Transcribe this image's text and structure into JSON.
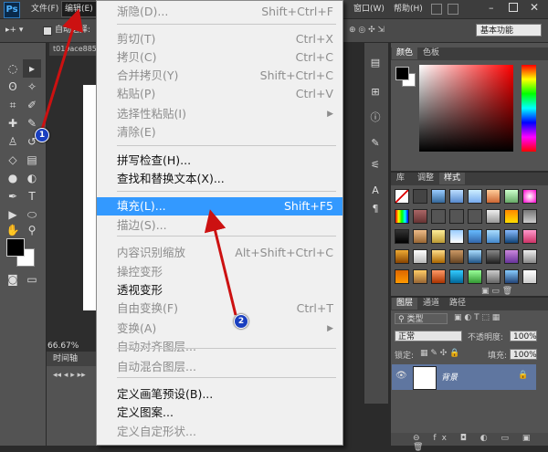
{
  "app": {
    "logo": "Ps"
  },
  "menubar": {
    "file": "文件(F)",
    "edit": "编辑(E)",
    "window": "窗口(W)",
    "help": "帮助(H)"
  },
  "options": {
    "auto_select": "自动选择:",
    "workspace": "基本功能"
  },
  "document": {
    "tab": "t019ace885",
    "zoom": "66.67%"
  },
  "timeline": {
    "label": "时间轴"
  },
  "edit_menu": {
    "items": [
      {
        "label": "渐隐(D)...",
        "shortcut": "Shift+Ctrl+F",
        "state": "disabled"
      },
      {
        "label": "剪切(T)",
        "shortcut": "Ctrl+X",
        "state": "disabled"
      },
      {
        "label": "拷贝(C)",
        "shortcut": "Ctrl+C",
        "state": "disabled"
      },
      {
        "label": "合并拷贝(Y)",
        "shortcut": "Shift+Ctrl+C",
        "state": "disabled"
      },
      {
        "label": "粘贴(P)",
        "shortcut": "Ctrl+V",
        "state": "disabled"
      },
      {
        "label": "选择性粘贴(I)",
        "shortcut": "",
        "state": "disabled"
      },
      {
        "label": "清除(E)",
        "shortcut": "",
        "state": "disabled"
      },
      {
        "label": "拼写检查(H)...",
        "shortcut": "",
        "state": "enabled"
      },
      {
        "label": "查找和替换文本(X)...",
        "shortcut": "",
        "state": "enabled"
      },
      {
        "label": "填充(L)...",
        "shortcut": "Shift+F5",
        "state": "highlighted"
      },
      {
        "label": "描边(S)...",
        "shortcut": "",
        "state": "disabled"
      },
      {
        "label": "内容识别缩放",
        "shortcut": "Alt+Shift+Ctrl+C",
        "state": "disabled"
      },
      {
        "label": "操控变形",
        "shortcut": "",
        "state": "disabled"
      },
      {
        "label": "透视变形",
        "shortcut": "",
        "state": "enabled"
      },
      {
        "label": "自由变换(F)",
        "shortcut": "Ctrl+T",
        "state": "disabled"
      },
      {
        "label": "变换(A)",
        "shortcut": "",
        "state": "disabled"
      },
      {
        "label": "自动对齐图层...",
        "shortcut": "",
        "state": "disabled"
      },
      {
        "label": "自动混合图层...",
        "shortcut": "",
        "state": "disabled"
      },
      {
        "label": "定义画笔预设(B)...",
        "shortcut": "",
        "state": "enabled"
      },
      {
        "label": "定义图案...",
        "shortcut": "",
        "state": "enabled"
      },
      {
        "label": "定义自定形状...",
        "shortcut": "",
        "state": "disabled"
      }
    ]
  },
  "panels": {
    "color_tab": "颜色",
    "swatches_tab": "色板",
    "library_tab": "库",
    "adjust_tab": "调整",
    "styles_tab": "样式",
    "layers_tab": "图层",
    "channels_tab": "通道",
    "paths_tab": "路径",
    "kind_filter": "类型",
    "blend_mode": "正常",
    "opacity_label": "不透明度:",
    "opacity_value": "100%",
    "lock_label": "锁定:",
    "fill_label": "填充:",
    "fill_value": "100%",
    "layer_name": "背景"
  },
  "annotations": {
    "badge1": "1",
    "badge2": "2",
    "color": "#cc1111"
  },
  "colors": {
    "highlight": "#3399ff",
    "layer_selected": "#5f76a0"
  }
}
